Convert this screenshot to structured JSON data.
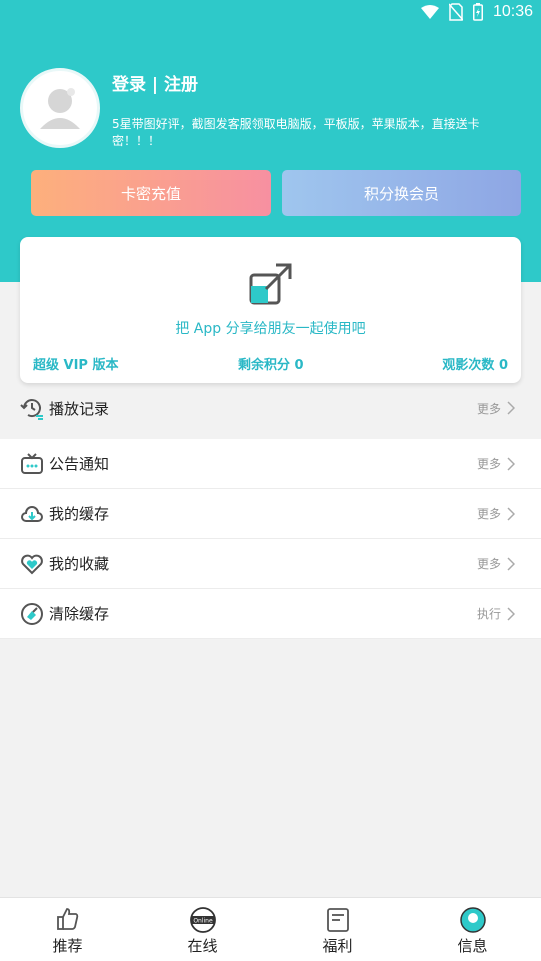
{
  "status_bar": {
    "time": "10:36"
  },
  "profile": {
    "login_text": "登录 | 注册",
    "slogan": "5星带图好评，截图发客服领取电脑版，平板版，苹果版本，直接送卡密！！！"
  },
  "actions": {
    "recharge_label": "卡密充值",
    "exchange_label": "积分换会员"
  },
  "card": {
    "share_text": "把 App 分享给朋友一起使用吧",
    "vip_label": "超级 VIP 版本",
    "points_label": "剩余积分 0",
    "views_label": "观影次数 0"
  },
  "menu": {
    "items": [
      {
        "label": "播放记录",
        "action": "更多",
        "icon": "history-icon"
      },
      {
        "label": "公告通知",
        "action": "更多",
        "icon": "announcement-icon"
      },
      {
        "label": "我的缓存",
        "action": "更多",
        "icon": "cloud-icon"
      },
      {
        "label": "我的收藏",
        "action": "更多",
        "icon": "heart-icon"
      },
      {
        "label": "清除缓存",
        "action": "执行",
        "icon": "broom-icon"
      }
    ]
  },
  "tabs": [
    {
      "label": "推荐",
      "icon": "thumbs-up-icon"
    },
    {
      "label": "在线",
      "icon": "online-globe-icon",
      "icon_text": "Online"
    },
    {
      "label": "福利",
      "icon": "document-icon"
    },
    {
      "label": "信息",
      "icon": "info-icon"
    }
  ],
  "colors": {
    "primary": "#2ec9c9",
    "accent_text": "#2ab8c6"
  }
}
